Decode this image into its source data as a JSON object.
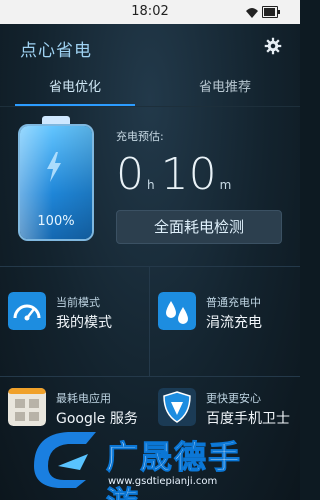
{
  "status_bar": {
    "time": "18:02"
  },
  "header": {
    "title": "点心省电"
  },
  "tabs": [
    {
      "label": "省电优化",
      "active": true
    },
    {
      "label": "省电推荐",
      "active": false
    }
  ],
  "battery": {
    "percent_label": "100%",
    "level": 1.0
  },
  "charge_estimate": {
    "label": "充电预估:",
    "hours": "0",
    "hours_unit": "h",
    "minutes": "10",
    "minutes_unit": "m"
  },
  "check_button": {
    "label": "全面耗电检测"
  },
  "modes": [
    {
      "title": "当前模式",
      "value": "我的模式",
      "icon": "speedometer-icon"
    },
    {
      "title": "普通充电中",
      "value": "涓流充电",
      "icon": "water-drops-icon"
    },
    {
      "title": "最耗电应用",
      "value": "Google 服务",
      "icon": "app-grid-icon"
    },
    {
      "title": "更快更安心",
      "value": "百度手机卫士",
      "icon": "shield-icon"
    }
  ],
  "watermark": {
    "name": "广晟德手游",
    "site": "www.gsdtiepianji.com"
  },
  "colors": {
    "accent": "#2c9cff",
    "title": "#9fd2f2",
    "background": "#13232e"
  }
}
